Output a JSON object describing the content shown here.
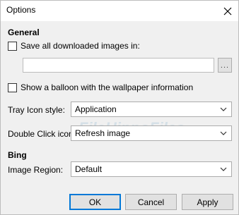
{
  "window": {
    "title": "Options",
    "close_glyph": "close-icon"
  },
  "general": {
    "heading": "General",
    "save_all_label": "Save all downloaded images in:",
    "save_all_checked": false,
    "folder_path_value": "",
    "browse_label": "...",
    "balloon_label": "Show a balloon with the wallpaper information",
    "balloon_checked": false,
    "tray_icon_label": "Tray Icon style:",
    "tray_icon_value": "Application",
    "double_click_label": "Double Click icon:",
    "double_click_value": "Refresh image"
  },
  "bing": {
    "heading": "Bing",
    "image_region_label": "Image Region:",
    "image_region_value": "Default"
  },
  "buttons": {
    "ok": "OK",
    "cancel": "Cancel",
    "apply": "Apply"
  },
  "watermark": "FileHippoFiles",
  "colors": {
    "dialog_bg": "#f0f0f0",
    "default_button_border": "#0078d7"
  }
}
